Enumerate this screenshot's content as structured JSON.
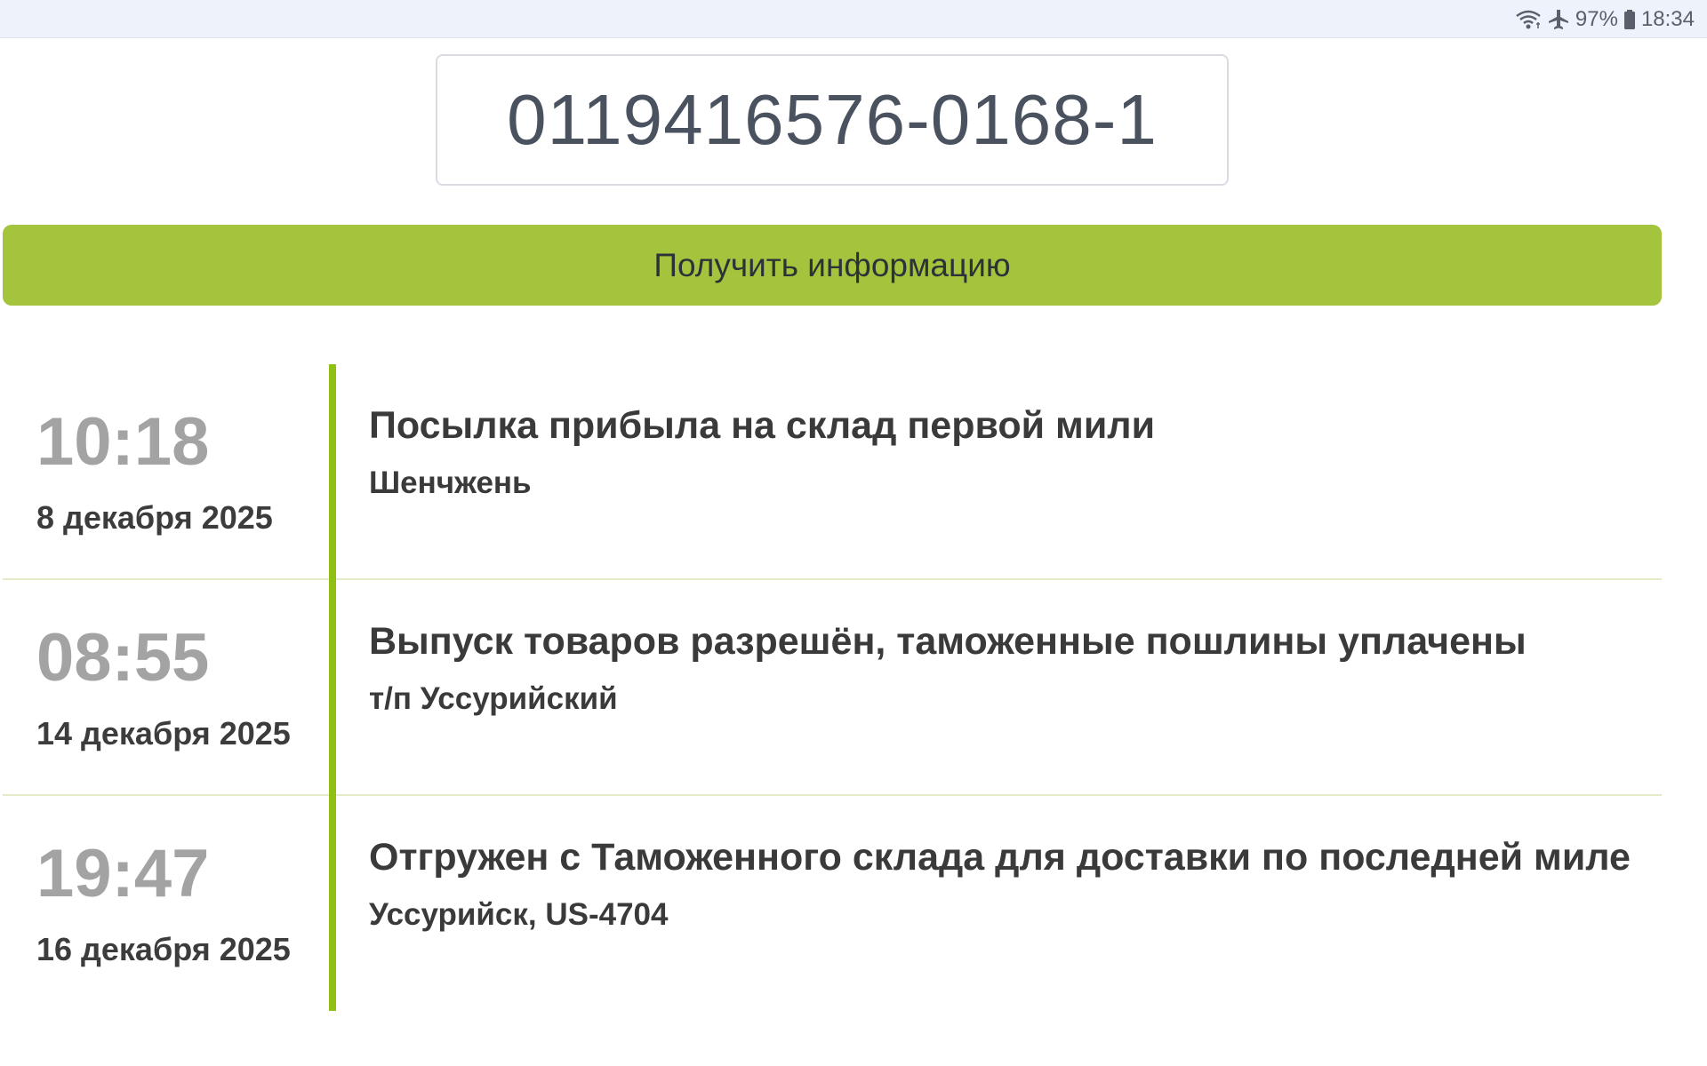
{
  "status_bar": {
    "battery": "97%",
    "time": "18:34",
    "icons": [
      "wifi-icon",
      "airplane-icon",
      "battery-icon"
    ]
  },
  "tracking": {
    "number": "0119416576-0168-1"
  },
  "actions": {
    "get_info_label": "Получить информацию"
  },
  "colors": {
    "accent_button": "#a5c43d",
    "timeline_line": "#8fbf13"
  },
  "events": [
    {
      "time": "10:18",
      "date": "8 декабря 2025",
      "title": "Посылка прибыла на склад первой мили",
      "location": "Шенчжень"
    },
    {
      "time": "08:55",
      "date": "14 декабря 2025",
      "title": "Выпуск товаров разрешён, таможенные пошлины уплачены",
      "location": "т/п Уссурийский"
    },
    {
      "time": "19:47",
      "date": "16 декабря 2025",
      "title": "Отгружен с Таможенного склада для доставки по последней миле",
      "location": "Уссурийск, US-4704"
    }
  ]
}
